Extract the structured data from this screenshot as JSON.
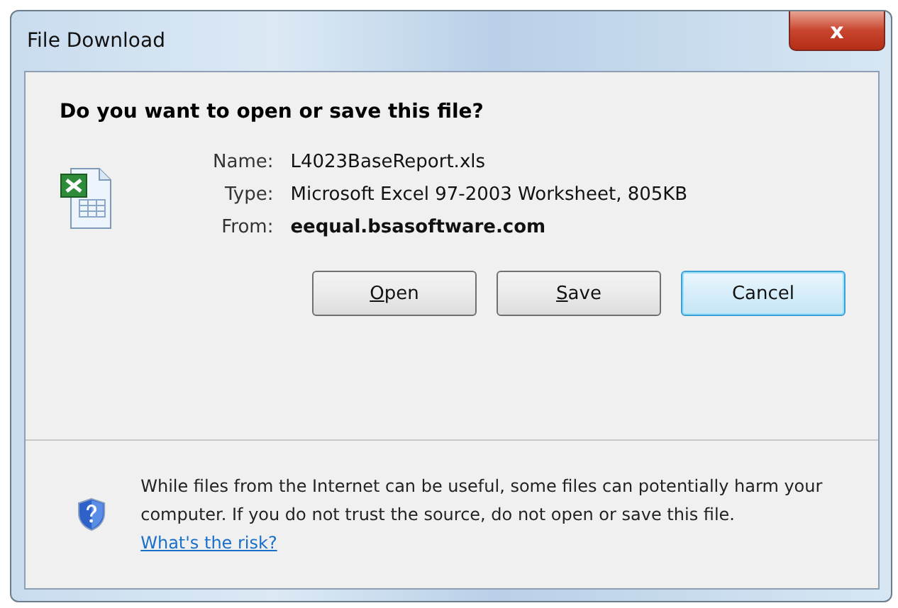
{
  "window": {
    "title": "File Download",
    "close": "x"
  },
  "heading": "Do you want to open or save this file?",
  "file_details": [
    {
      "label": "Name:",
      "value": "L4023BaseReport.xls",
      "bold": false
    },
    {
      "label": "Type:",
      "value": "Microsoft Excel 97-2003 Worksheet, 805KB",
      "bold": false
    },
    {
      "label": "From:",
      "value": "eequal.bsasoftware.com",
      "bold": true
    }
  ],
  "buttons": [
    {
      "label": "Open",
      "mnemonic": true,
      "default": false
    },
    {
      "label": "Save",
      "mnemonic": true,
      "default": false
    },
    {
      "label": "Cancel",
      "mnemonic": false,
      "default": true
    }
  ],
  "warning": {
    "text": "While files from the Internet can be useful, some files can potentially harm your computer. If you do not trust the source, do not open or save this file.",
    "link": "What's the risk?"
  }
}
